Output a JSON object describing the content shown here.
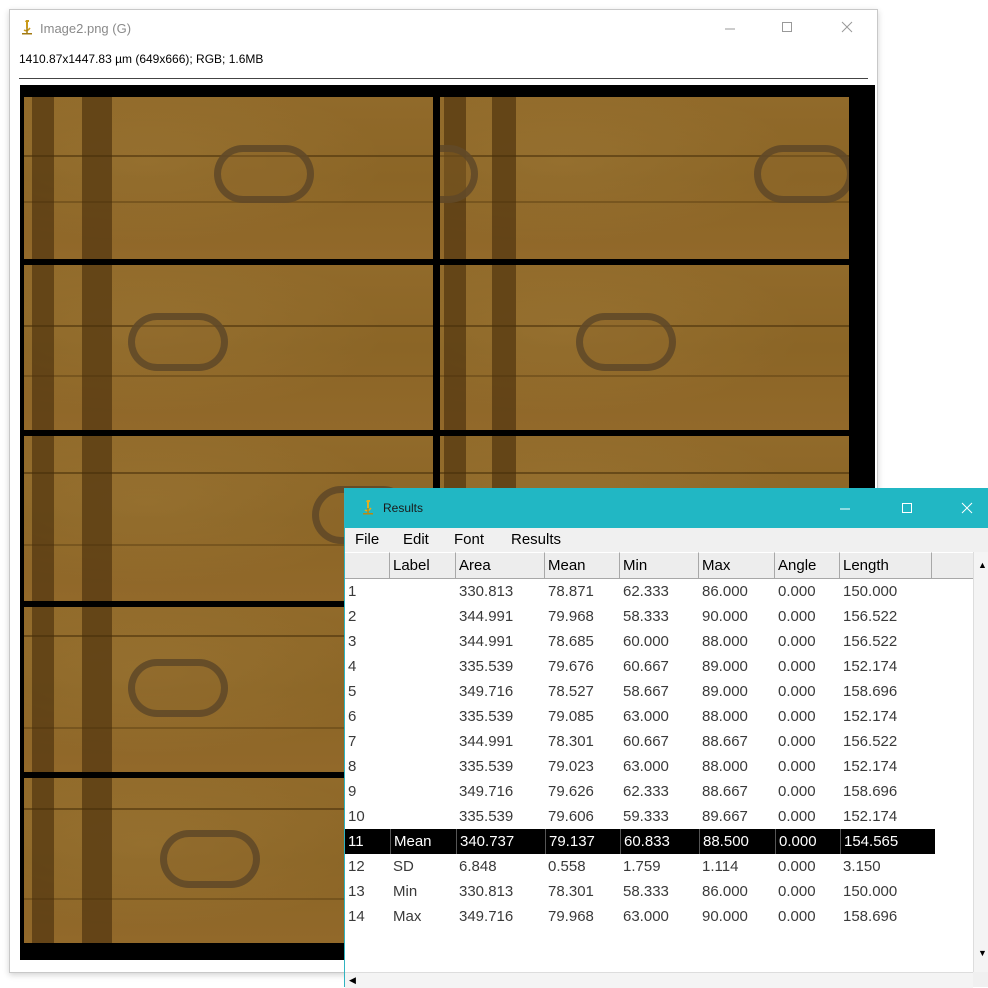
{
  "image_window": {
    "title": "Image2.png (G)",
    "info": "1410.87x1447.83 µm (649x666); RGB; 1.6MB"
  },
  "results_window": {
    "title": "Results",
    "menu": [
      "File",
      "Edit",
      "Font",
      "Results"
    ],
    "columns": [
      "",
      "Label",
      "Area",
      "Mean",
      "Min",
      "Max",
      "Angle",
      "Length"
    ],
    "rows": [
      [
        "1",
        "",
        "330.813",
        "78.871",
        "62.333",
        "86.000",
        "0.000",
        "150.000"
      ],
      [
        "2",
        "",
        "344.991",
        "79.968",
        "58.333",
        "90.000",
        "0.000",
        "156.522"
      ],
      [
        "3",
        "",
        "344.991",
        "78.685",
        "60.000",
        "88.000",
        "0.000",
        "156.522"
      ],
      [
        "4",
        "",
        "335.539",
        "79.676",
        "60.667",
        "89.000",
        "0.000",
        "152.174"
      ],
      [
        "5",
        "",
        "349.716",
        "78.527",
        "58.667",
        "89.000",
        "0.000",
        "158.696"
      ],
      [
        "6",
        "",
        "335.539",
        "79.085",
        "63.000",
        "88.000",
        "0.000",
        "152.174"
      ],
      [
        "7",
        "",
        "344.991",
        "78.301",
        "60.667",
        "88.667",
        "0.000",
        "156.522"
      ],
      [
        "8",
        "",
        "335.539",
        "79.023",
        "63.000",
        "88.000",
        "0.000",
        "152.174"
      ],
      [
        "9",
        "",
        "349.716",
        "79.626",
        "62.333",
        "88.667",
        "0.000",
        "158.696"
      ],
      [
        "10",
        "",
        "335.539",
        "79.606",
        "59.333",
        "89.667",
        "0.000",
        "152.174"
      ],
      [
        "11",
        "Mean",
        "340.737",
        "79.137",
        "60.833",
        "88.500",
        "0.000",
        "154.565"
      ],
      [
        "12",
        "SD",
        "6.848",
        "0.558",
        "1.759",
        "1.114",
        "0.000",
        "3.150"
      ],
      [
        "13",
        "Min",
        "330.813",
        "78.301",
        "58.333",
        "86.000",
        "0.000",
        "150.000"
      ],
      [
        "14",
        "Max",
        "349.716",
        "79.968",
        "63.000",
        "90.000",
        "0.000",
        "158.696"
      ]
    ],
    "selected_row": 10
  },
  "colors": {
    "results_titlebar": "#21b7c4",
    "selection_bg": "#000000",
    "specimen_bg": "#8b6526"
  },
  "icons": [
    "microscope-icon",
    "minimize-icon",
    "maximize-icon",
    "close-icon"
  ]
}
